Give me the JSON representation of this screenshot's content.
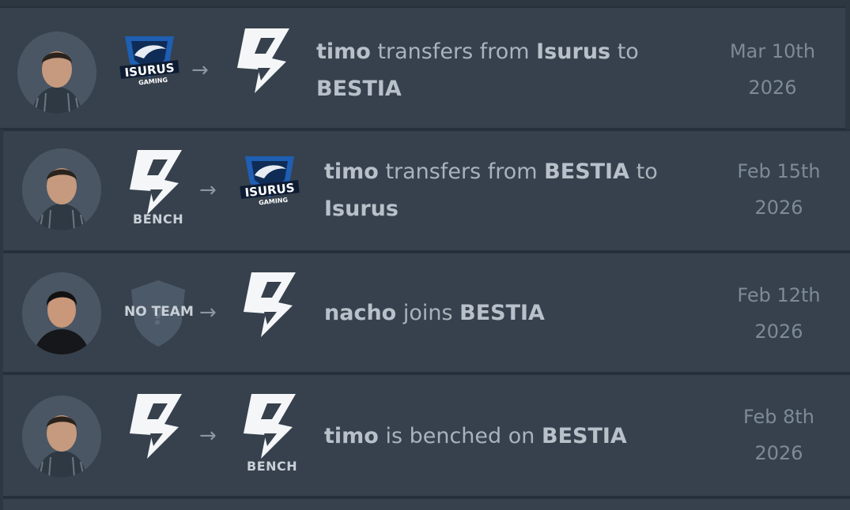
{
  "transfers": [
    {
      "player": "timo",
      "verb1": "transfers from",
      "from_team": "Isurus",
      "verb2": "to",
      "to_team": "BESTIA",
      "date_line1": "Mar 10th",
      "date_line2": "2026",
      "from_logo": "isurus-logo",
      "to_logo": "bestia-logo"
    },
    {
      "player": "timo",
      "verb1": "transfers from",
      "from_team": "BESTIA",
      "verb2": "to",
      "to_team": "Isurus",
      "from_tag": "BENCH",
      "date_line1": "Feb 15th",
      "date_line2": "2026",
      "from_logo": "bestia-logo",
      "to_logo": "isurus-logo"
    },
    {
      "player": "nacho",
      "verb1": "joins",
      "to_team": "BESTIA",
      "from_tag": "NO TEAM",
      "date_line1": "Feb 12th",
      "date_line2": "2026",
      "from_logo": "no-team-shield",
      "to_logo": "bestia-logo"
    },
    {
      "player": "timo",
      "verb1": "is benched on",
      "to_team": "BESTIA",
      "to_tag": "BENCH",
      "date_line1": "Feb 8th",
      "date_line2": "2026",
      "from_logo": "bestia-logo",
      "to_logo": "bestia-logo"
    }
  ],
  "isurus_logo_text": {
    "line1": "ISURUS",
    "line2": "GAMING"
  },
  "arrow_glyph": "→",
  "colors": {
    "row_bg": "#36414d",
    "isurus_blue": "#1e5fb3"
  }
}
